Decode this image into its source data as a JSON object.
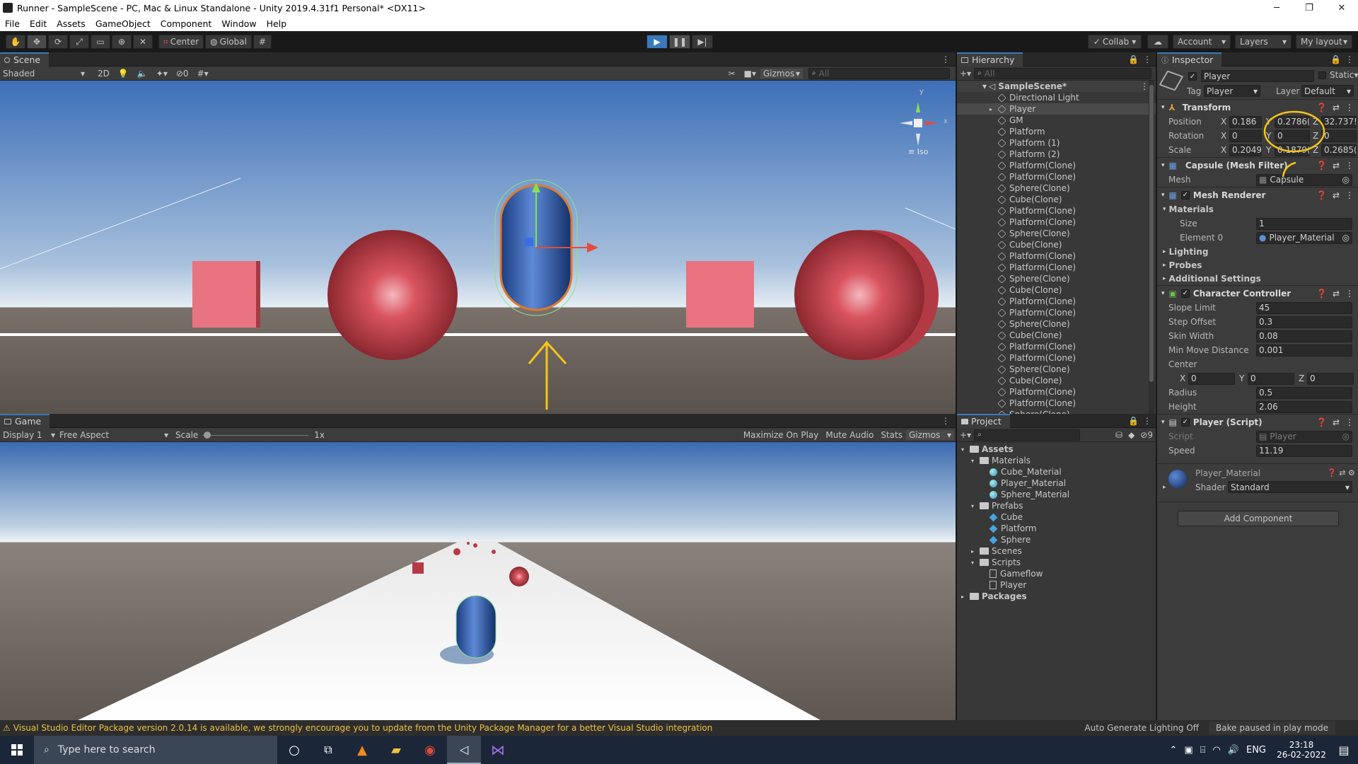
{
  "window": {
    "title": "Runner - SampleScene - PC, Mac & Linux Standalone - Unity 2019.4.31f1 Personal* <DX11>",
    "minimize": "─",
    "maximize": "❐",
    "close": "✕"
  },
  "menu": [
    "File",
    "Edit",
    "Assets",
    "GameObject",
    "Component",
    "Window",
    "Help"
  ],
  "toolbar": {
    "center": "Center",
    "global": "Global",
    "collab": "Collab",
    "account": "Account",
    "layers": "Layers",
    "layout": "My layout"
  },
  "scene": {
    "tab": "Scene",
    "shading": "Shaded",
    "mode2d": "2D",
    "hidden_count": "0",
    "gizmos": "Gizmos",
    "search_placeholder": "All",
    "persp_label": "Iso",
    "axis_x": "x",
    "axis_y": "y"
  },
  "game": {
    "tab": "Game",
    "display": "Display 1",
    "aspect": "Free Aspect",
    "scale_label": "Scale",
    "scale_value": "1x",
    "maximize": "Maximize On Play",
    "mute": "Mute Audio",
    "stats": "Stats",
    "gizmos": "Gizmos"
  },
  "hierarchy": {
    "tab": "Hierarchy",
    "search_placeholder": "All",
    "scene": "SampleScene*",
    "items": [
      "Directional Light",
      "Player",
      "GM",
      "Platform",
      "Platform (1)",
      "Platform (2)",
      "Platform(Clone)",
      "Platform(Clone)",
      "Sphere(Clone)",
      "Cube(Clone)",
      "Platform(Clone)",
      "Platform(Clone)",
      "Sphere(Clone)",
      "Cube(Clone)",
      "Platform(Clone)",
      "Platform(Clone)",
      "Sphere(Clone)",
      "Cube(Clone)",
      "Platform(Clone)",
      "Platform(Clone)",
      "Sphere(Clone)",
      "Cube(Clone)",
      "Platform(Clone)",
      "Platform(Clone)",
      "Sphere(Clone)",
      "Cube(Clone)",
      "Platform(Clone)",
      "Platform(Clone)",
      "Sphere(Clone)"
    ]
  },
  "project": {
    "tab": "Project",
    "hidden_count": "9",
    "tree": [
      {
        "label": "Assets",
        "level": 0,
        "type": "folder",
        "bold": true
      },
      {
        "label": "Materials",
        "level": 1,
        "type": "folder"
      },
      {
        "label": "Cube_Material",
        "level": 2,
        "type": "material"
      },
      {
        "label": "Player_Material",
        "level": 2,
        "type": "material"
      },
      {
        "label": "Sphere_Material",
        "level": 2,
        "type": "material"
      },
      {
        "label": "Prefabs",
        "level": 1,
        "type": "folder"
      },
      {
        "label": "Cube",
        "level": 2,
        "type": "prefab"
      },
      {
        "label": "Platform",
        "level": 2,
        "type": "prefab"
      },
      {
        "label": "Sphere",
        "level": 2,
        "type": "prefab"
      },
      {
        "label": "Scenes",
        "level": 1,
        "type": "folder"
      },
      {
        "label": "Scripts",
        "level": 1,
        "type": "folder"
      },
      {
        "label": "Gameflow",
        "level": 2,
        "type": "script"
      },
      {
        "label": "Player",
        "level": 2,
        "type": "script"
      },
      {
        "label": "Packages",
        "level": 0,
        "type": "folder",
        "bold": true
      }
    ]
  },
  "inspector": {
    "tab": "Inspector",
    "object_name": "Player",
    "static_label": "Static",
    "tag_label": "Tag",
    "tag_value": "Player",
    "layer_label": "Layer",
    "layer_value": "Default",
    "transform": {
      "title": "Transform",
      "position_label": "Position",
      "pos_x": "0.186",
      "pos_y": "0.2786(",
      "pos_z": "32.737!",
      "rotation_label": "Rotation",
      "rot_x": "0",
      "rot_y": "0",
      "rot_z": "0",
      "scale_label": "Scale",
      "scl_x": "0.2049",
      "scl_y": "0.1879(",
      "scl_z": "0.2685("
    },
    "mesh_filter": {
      "title": "Capsule (Mesh Filter)",
      "mesh_label": "Mesh",
      "mesh_value": "Capsule"
    },
    "mesh_renderer": {
      "title": "Mesh Renderer",
      "materials": "Materials",
      "size_label": "Size",
      "size_value": "1",
      "element_label": "Element 0",
      "element_value": "Player_Material",
      "lighting": "Lighting",
      "probes": "Probes",
      "additional": "Additional Settings"
    },
    "character_controller": {
      "title": "Character Controller",
      "slope_label": "Slope Limit",
      "slope": "45",
      "step_label": "Step Offset",
      "step": "0.3",
      "skin_label": "Skin Width",
      "skin": "0.08",
      "minmove_label": "Min Move Distance",
      "minmove": "0.001",
      "center_label": "Center",
      "cx": "0",
      "cy": "0",
      "cz": "0",
      "radius_label": "Radius",
      "radius": "0.5",
      "height_label": "Height",
      "height": "2.06"
    },
    "player_script": {
      "title": "Player (Script)",
      "script_label": "Script",
      "script_value": "Player",
      "speed_label": "Speed",
      "speed": "11.19"
    },
    "material": {
      "name": "Player_Material",
      "shader_label": "Shader",
      "shader": "Standard"
    },
    "add_component": "Add Component"
  },
  "status": {
    "message": "Visual Studio Editor Package version 2.0.14 is available, we strongly encourage you to update from the Unity Package Manager for a better Visual Studio integration",
    "lighting": "Auto Generate Lighting Off",
    "bake": "Bake paused in play mode"
  },
  "taskbar": {
    "search_placeholder": "Type here to search",
    "lang": "ENG",
    "time": "23:18",
    "date": "26-02-2022"
  },
  "colors": {
    "accent": "#3a79bb",
    "annotation": "#f5c518",
    "obstacle": "#d9545f",
    "player": "#2a5aa8"
  }
}
